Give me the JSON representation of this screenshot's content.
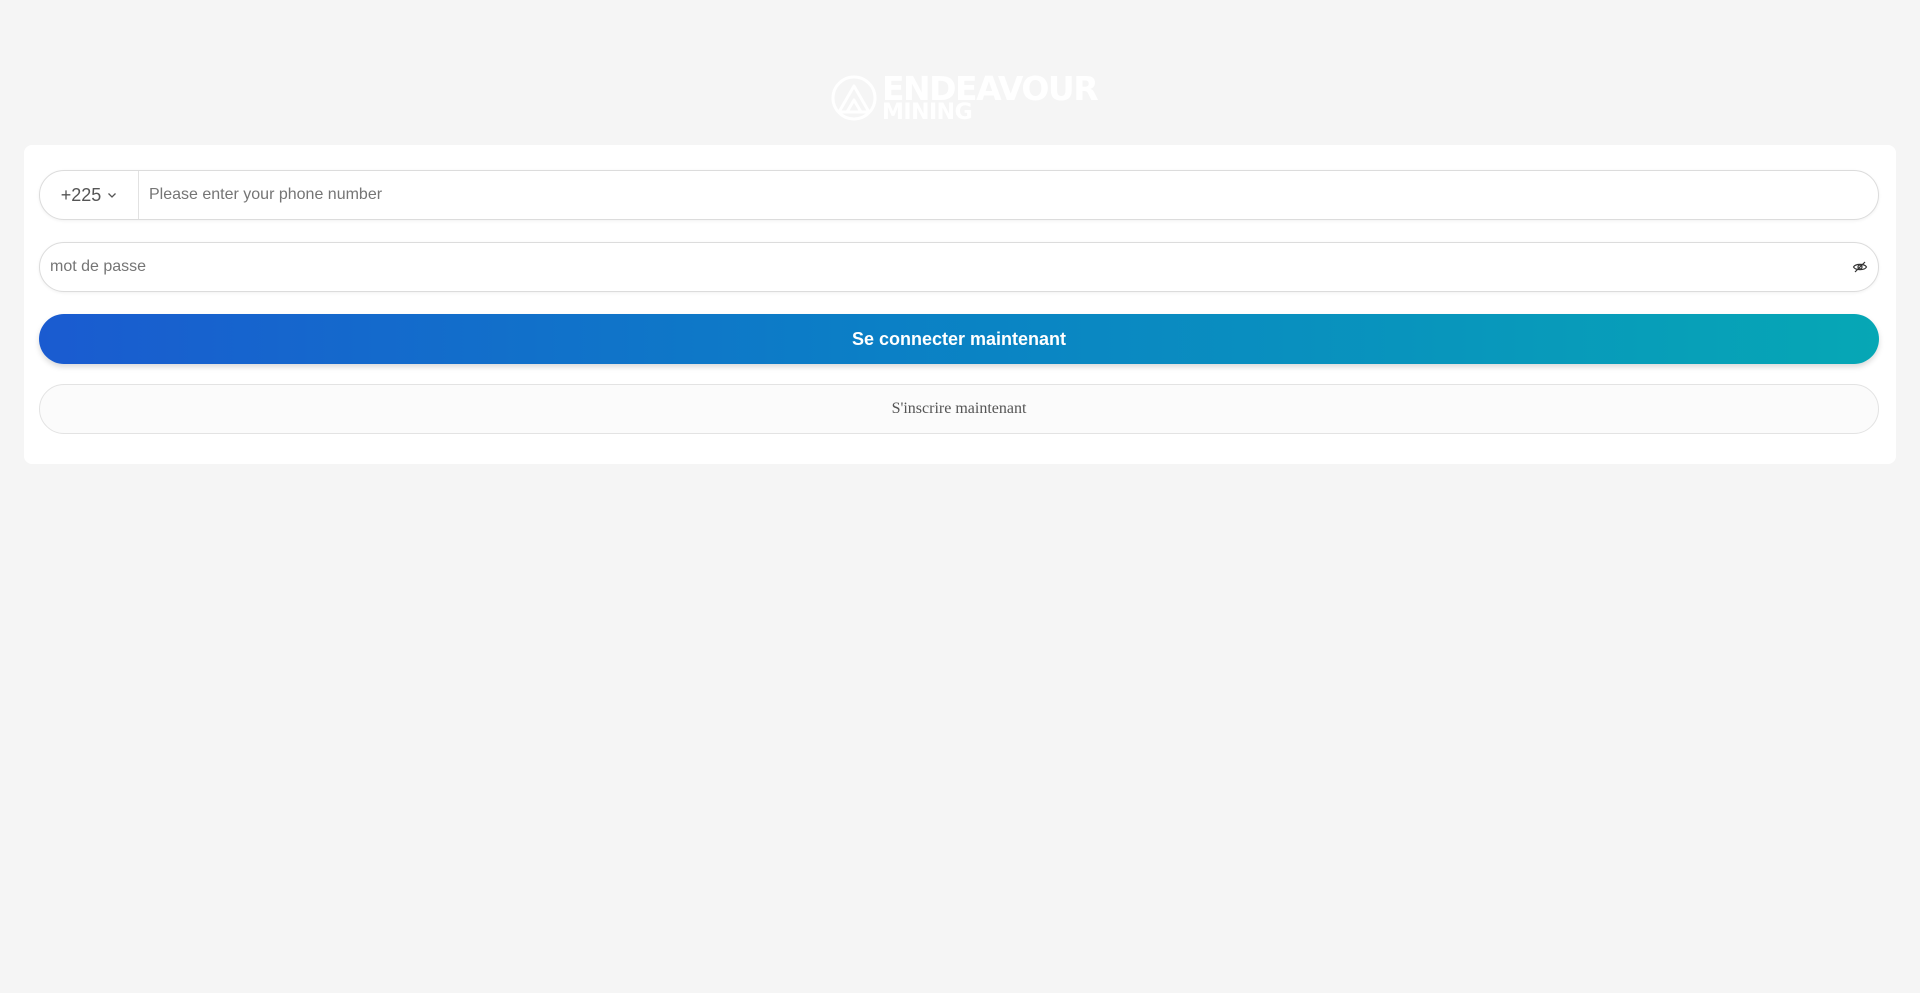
{
  "logo": {
    "line1": "ENDEAVOUR",
    "line2": "MINING",
    "icon": "endeavour-triangle-logo-icon",
    "color": "#ffffff"
  },
  "login_form": {
    "country_code": "+225",
    "country_chevron_icon": "chevron-down-icon",
    "phone_placeholder": "Please enter your phone number",
    "phone_value": "",
    "password_placeholder": "mot de passe",
    "password_value": "",
    "password_toggle_icon": "eye-slash-icon",
    "login_button": "Se connecter maintenant",
    "register_button": "S'inscrire maintenant"
  },
  "colors": {
    "background": "#f5f5f5",
    "card": "#ffffff",
    "gradient_start": "#1a5bd0",
    "gradient_end": "#06a7b5"
  }
}
